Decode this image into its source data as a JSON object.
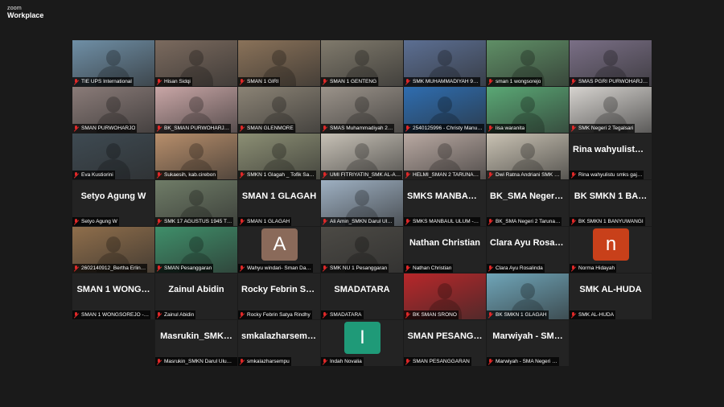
{
  "app": {
    "brand_line1": "zoom",
    "brand_line2": "Workplace"
  },
  "colors": {
    "active_speaker": "#2fd05a",
    "muted_mic": "#e02828"
  },
  "participants": [
    {
      "label": "TIE UPS International",
      "display_name": "",
      "video": true,
      "tone": "#6f8fa6"
    },
    {
      "label": "Hisan Sidqi",
      "display_name": "",
      "video": true,
      "tone": "#7b6a5e"
    },
    {
      "label": "SMAN 1 GIRI",
      "display_name": "",
      "video": true,
      "tone": "#8a7259"
    },
    {
      "label": "SMAN 1 GENTENG",
      "display_name": "",
      "video": true,
      "tone": "#807a6c"
    },
    {
      "label": "SMK MUHAMMADIYAH 9…",
      "display_name": "",
      "video": true,
      "tone": "#5c6f93"
    },
    {
      "label": "sman 1 wongsorejo",
      "display_name": "",
      "video": true,
      "tone": "#5f8f66"
    },
    {
      "label": "SMAS PGRI PURWOHARJ…",
      "display_name": "",
      "video": true,
      "tone": "#7a6f86"
    },
    {
      "label": "SMAN PURWOHARJO",
      "display_name": "",
      "video": true,
      "tone": "#8a7b78"
    },
    {
      "label": "BK_SMAN PURWOHARJ…",
      "display_name": "",
      "video": true,
      "tone": "#c9a6a6"
    },
    {
      "label": "SMAN GLENMORE",
      "display_name": "",
      "video": true,
      "tone": "#8b8375"
    },
    {
      "label": "SMAS Muhammadiyah 2…",
      "display_name": "",
      "video": true,
      "tone": "#9b938a"
    },
    {
      "label": "2540125996 - Christy Manu…",
      "display_name": "",
      "video": true,
      "tone": "#2e6db0",
      "active": true
    },
    {
      "label": "lisa waranita",
      "display_name": "",
      "video": true,
      "tone": "#5aa875"
    },
    {
      "label": "SMK Negeri 2 Tegalsari",
      "display_name": "",
      "video": true,
      "tone": "#d6d3cf"
    },
    {
      "label": "Eva Kustiorini",
      "display_name": "",
      "video": true,
      "tone": "#3e4a52"
    },
    {
      "label": "Sukaesih, kab.cirebon",
      "display_name": "",
      "video": true,
      "tone": "#b78e6b"
    },
    {
      "label": "SMKN 1 Glagah _ Tofik Sa…",
      "display_name": "",
      "video": true,
      "tone": "#8c8f74"
    },
    {
      "label": "UMI FITRIYATIN_SMK AL-A…",
      "display_name": "",
      "video": true,
      "tone": "#c7c1b6"
    },
    {
      "label": "HELMI_SMAN 2 TARUNA…",
      "display_name": "",
      "video": true,
      "tone": "#b9a9a2"
    },
    {
      "label": "Dwi Ratna Andriani SMK …",
      "display_name": "",
      "video": true,
      "tone": "#c9c2b3"
    },
    {
      "label": "Rina wahyulistu smks gaj…",
      "display_name": "Rina wahyulistu…",
      "video": false
    },
    {
      "label": "Setyo Agung W",
      "display_name": "Setyo Agung W",
      "video": false
    },
    {
      "label": "SMK 17 AGUSTUS 1945 T…",
      "display_name": "",
      "video": true,
      "tone": "#6f7c67"
    },
    {
      "label": "SMAN 1 GLAGAH",
      "display_name": "SMAN 1 GLAGAH",
      "video": false
    },
    {
      "label": "Ali Amin_SMKN Darul Ul…",
      "display_name": "",
      "video": true,
      "tone": "#9eb0c2"
    },
    {
      "label": "SMKS MANBAUL ULUM -…",
      "display_name": "SMKS MANBAU…",
      "video": false
    },
    {
      "label": "BK_SMA Negeri 2 Taruna…",
      "display_name": "BK_SMA Negeri…",
      "video": false
    },
    {
      "label": "BK SMKN 1 BANYUWANGI",
      "display_name": "BK SMKN 1 BA…",
      "video": false
    },
    {
      "label": "2602140912_Bertha Erlin…",
      "display_name": "",
      "video": true,
      "tone": "#8f6e4b"
    },
    {
      "label": "SMAN Pesanggaran",
      "display_name": "",
      "video": true,
      "tone": "#3f8f6a"
    },
    {
      "label": "Wahyu windari- Sman Da…",
      "display_name": "",
      "avatar_letter": "A",
      "avatar_color": "#8a6a5a"
    },
    {
      "label": "SMK NU 1 Pesanggaran",
      "display_name": "",
      "video": true,
      "tone": "#4c4a45"
    },
    {
      "label": "Nathan Christian",
      "display_name": "Nathan Christian",
      "video": false
    },
    {
      "label": "Clara Ayu Rosalinda",
      "display_name": "Clara Ayu Rosall…",
      "video": false
    },
    {
      "label": "Norma Hidayah",
      "display_name": "",
      "avatar_letter": "n",
      "avatar_color": "#c8401a"
    },
    {
      "label": "SMAN 1 WONGSOREJO -…",
      "display_name": "SMAN 1 WONG…",
      "video": false
    },
    {
      "label": "Zainul Abidin",
      "display_name": "Zainul Abidin",
      "video": false
    },
    {
      "label": "Rocky Febrin Satya Rindhy",
      "display_name": "Rocky Febrin Sa…",
      "video": false
    },
    {
      "label": "SMADATARA",
      "display_name": "SMADATARA",
      "video": false
    },
    {
      "label": "BK SMAN SRONO",
      "display_name": "",
      "video": true,
      "tone": "#b8272a"
    },
    {
      "label": "BK SMKN 1 GLAGAH",
      "display_name": "",
      "video": true,
      "tone": "#6fa5b8"
    },
    {
      "label": "SMK AL-HUDA",
      "display_name": "SMK AL-HUDA",
      "video": false
    },
    {
      "label": "Masrukin_SMKN Darul Ulum…",
      "display_name": "Masrukin_SMK…",
      "video": false
    },
    {
      "label": "smkalazharsempu",
      "display_name": "smkalazharsempu",
      "video": false
    },
    {
      "label": "Indah Novalia",
      "display_name": "",
      "avatar_letter": "I",
      "avatar_color": "#1f9a78"
    },
    {
      "label": "SMAN PESANGGARAN",
      "display_name": "SMAN PESANG…",
      "video": false
    },
    {
      "label": "Marwiyah - SMA Negeri …",
      "display_name": "Marwiyah - SM…",
      "video": false
    }
  ]
}
